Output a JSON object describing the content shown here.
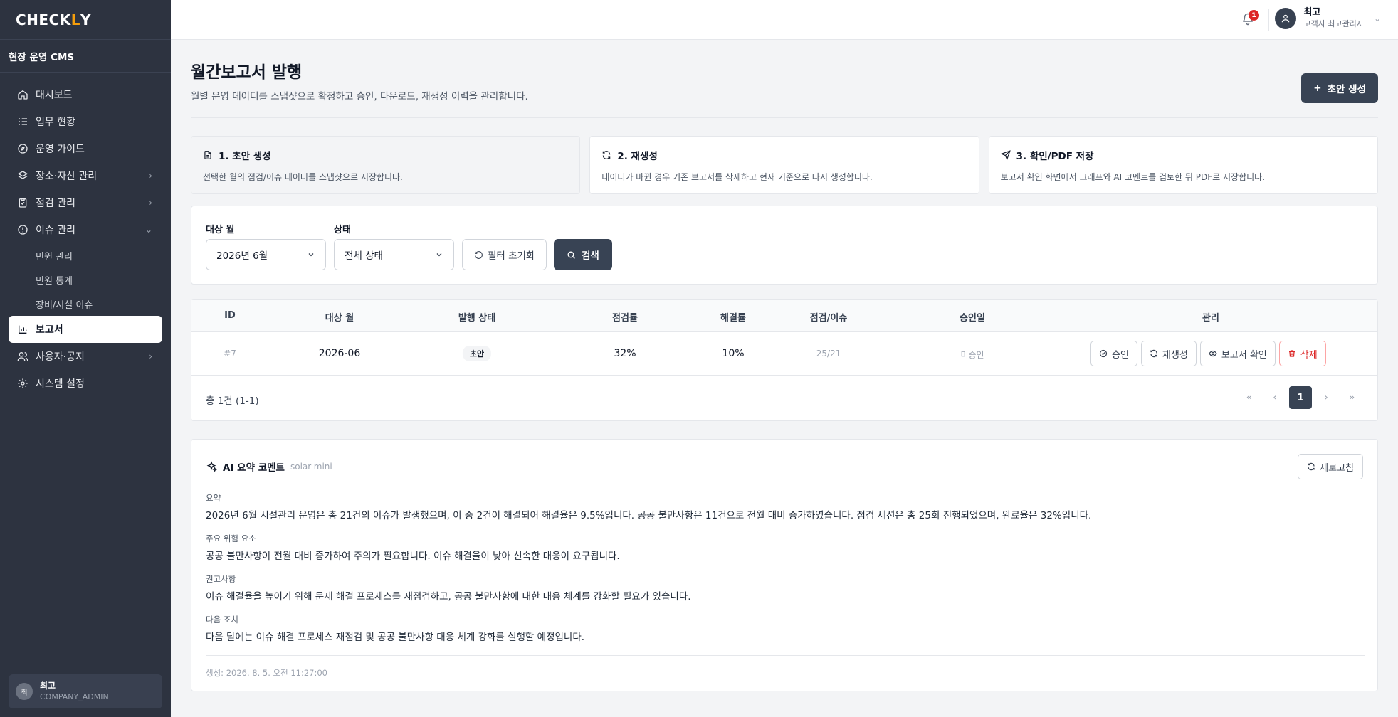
{
  "app": {
    "logo_main": "CHECK",
    "logo_accent": "L",
    "logo_tail": "Y",
    "cms_title": "현장 운영 CMS"
  },
  "sidebar": {
    "items": [
      {
        "label": "대시보드"
      },
      {
        "label": "업무 현황"
      },
      {
        "label": "운영 가이드"
      },
      {
        "label": "장소·자산 관리"
      },
      {
        "label": "점검 관리"
      },
      {
        "label": "이슈 관리"
      },
      {
        "label": "보고서"
      },
      {
        "label": "사용자·공지"
      },
      {
        "label": "시스템 설정"
      }
    ],
    "issue_sub": [
      "민원 관리",
      "민원 통계",
      "장비/시설 이슈"
    ],
    "user": {
      "avatar": "최",
      "name": "최고",
      "role": "COMPANY_ADMIN"
    }
  },
  "topbar": {
    "notif_count": "1",
    "user": {
      "name": "최고",
      "role": "고객사 최고관리자"
    }
  },
  "page": {
    "title": "월간보고서 발행",
    "desc": "월별 운영 데이터를 스냅샷으로 확정하고 승인, 다운로드, 재생성 이력을 관리합니다.",
    "create_btn": "초안 생성"
  },
  "steps": [
    {
      "title": "1. 초안 생성",
      "desc": "선택한 월의 점검/이슈 데이터를 스냅샷으로 저장합니다."
    },
    {
      "title": "2. 재생성",
      "desc": "데이터가 바뀐 경우 기존 보고서를 삭제하고 현재 기준으로 다시 생성합니다."
    },
    {
      "title": "3. 확인/PDF 저장",
      "desc": "보고서 확인 화면에서 그래프와 AI 코멘트를 검토한 뒤 PDF로 저장합니다."
    }
  ],
  "filter": {
    "month_label": "대상 월",
    "month_value": "2026년 6월",
    "status_label": "상태",
    "status_value": "전체 상태",
    "reset_btn": "필터 초기화",
    "search_btn": "검색"
  },
  "table": {
    "headers": [
      "ID",
      "대상 월",
      "발행 상태",
      "점검률",
      "해결률",
      "점검/이슈",
      "승인일",
      "관리"
    ],
    "row": {
      "id": "#7",
      "month": "2026-06",
      "status": "초안",
      "inspect_rate": "32%",
      "resolve_rate": "10%",
      "counts": "25/21",
      "approved": "미승인"
    },
    "actions": {
      "approve": "승인",
      "regen": "재생성",
      "view": "보고서 확인",
      "delete": "삭제"
    },
    "total": "총 1건 (1-1)",
    "pager": {
      "first": "«",
      "prev": "‹",
      "current": "1",
      "next": "›",
      "last": "»"
    }
  },
  "ai": {
    "title": "AI 요약 코멘트",
    "model": "solar-mini",
    "refresh_btn": "새로고침",
    "sections": [
      {
        "label": "요약",
        "body": "2026년 6월 시설관리 운영은 총 21건의 이슈가 발생했으며, 이 중 2건이 해결되어 해결율은 9.5%입니다. 공공 불만사항은 11건으로 전월 대비 증가하였습니다. 점검 세션은 총 25회 진행되었으며, 완료율은 32%입니다."
      },
      {
        "label": "주요 위험 요소",
        "body": "공공 불만사항이 전월 대비 증가하여 주의가 필요합니다. 이슈 해결율이 낮아 신속한 대응이 요구됩니다."
      },
      {
        "label": "권고사항",
        "body": "이슈 해결율을 높이기 위해 문제 해결 프로세스를 재점검하고, 공공 불만사항에 대한 대응 체계를 강화할 필요가 있습니다."
      },
      {
        "label": "다음 조치",
        "body": "다음 달에는 이슈 해결 프로세스 재점검 및 공공 불만사항 대응 체계 강화를 실행할 예정입니다."
      }
    ],
    "generated": "생성: 2026. 8. 5. 오전 11:27:00"
  }
}
